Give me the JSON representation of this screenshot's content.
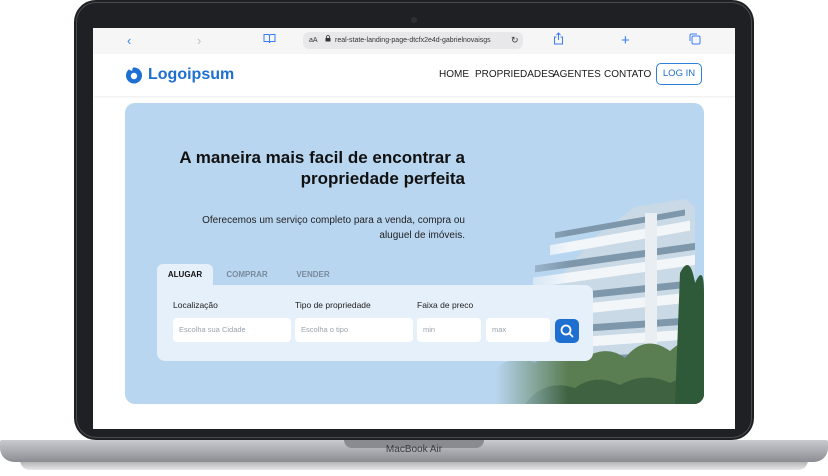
{
  "device": {
    "label": "MacBook Air"
  },
  "browser": {
    "address_prefix": "aA",
    "url": "real-state-landing-page-dtcfx2e4d-gabrielnovaisgs",
    "icons": [
      "chevron-left-icon",
      "chevron-right-icon",
      "book-icon",
      "lock-icon",
      "reload-icon",
      "share-icon",
      "plus-icon",
      "tabs-icon"
    ]
  },
  "nav": {
    "logo": "Logoipsum",
    "links": [
      "HOME",
      "PROPRIEDADES",
      "AGENTES",
      "CONTATO"
    ],
    "login": "LOG IN"
  },
  "hero": {
    "headline_line1": "A maneira mais facil de encontrar a",
    "headline_line2": "propriedade perfeita",
    "sub_line1": "Oferecemos um serviço completo para a venda, compra ou",
    "sub_line2": "aluguel de imóveis."
  },
  "search": {
    "tabs": [
      "ALUGAR",
      "COMPRAR",
      "VENDER"
    ],
    "active_tab": "ALUGAR",
    "labels": {
      "location": "Localização",
      "type": "Tipo de propriedade",
      "price": "Faixa de preco"
    },
    "placeholders": {
      "location": "Escolha sua Cidade",
      "type": "Escolha o tipo",
      "min": "min",
      "max": "max"
    }
  },
  "colors": {
    "brand": "#1d6fd1",
    "hero_bg": "#b9d6f1",
    "form_bg": "#e6f0fa"
  }
}
